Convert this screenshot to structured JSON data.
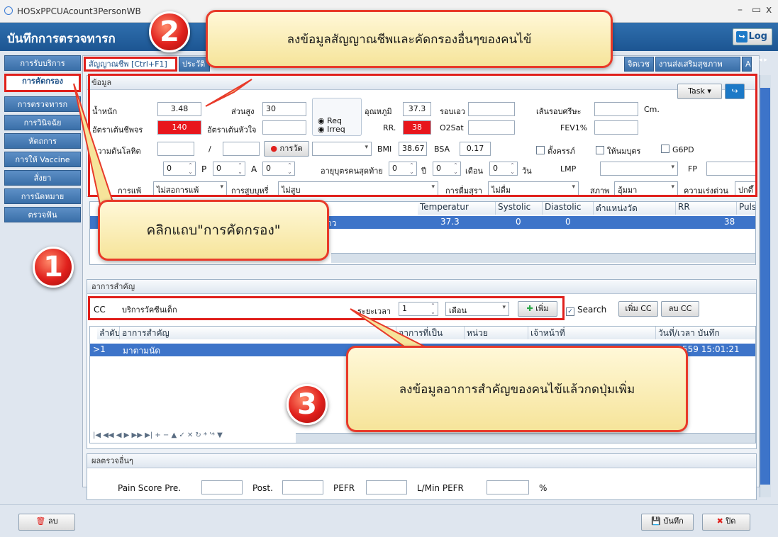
{
  "window": {
    "title": "HOSxPPCUAcount3PersonWB"
  },
  "header": {
    "title": "บันทึกการตรวจทารก",
    "log_label": "Log"
  },
  "sidebar": {
    "items": [
      {
        "label": "การรับบริการ"
      },
      {
        "label": "การคัดกรอง"
      },
      {
        "label": "การตรวจทารก"
      },
      {
        "label": "การวินิจฉัย"
      },
      {
        "label": "หัตถการ"
      },
      {
        "label": "การให้ Vaccine"
      },
      {
        "label": "สั่งยา"
      },
      {
        "label": "การนัดหมาย"
      },
      {
        "label": "ตรวจฟัน"
      }
    ]
  },
  "tabs": [
    {
      "label": "สัญญาณชีพ [Ctrl+F1]"
    },
    {
      "label": "ประวัติ"
    },
    {
      "label": "จิตเวช"
    },
    {
      "label": "งานส่งเสริมสุขภาพ"
    },
    {
      "label": "A"
    }
  ],
  "vitals": {
    "section_title": "ข้อมูล",
    "task_label": "Task",
    "weight_label": "น้ำหนัก",
    "weight": "3.48",
    "height_label": "ส่วนสูง",
    "height": "30",
    "temp_label": "อุณหภูมิ",
    "temp": "37.3",
    "waist_label": "รอบเอว",
    "head_label": "เส้นรอบศรีษะ",
    "head_unit": "Cm.",
    "pulse_label": "อัตราเต้นชีพจร",
    "pulse": "140",
    "heart_label": "อัตราเต้นหัวใจ",
    "req_label": "Req",
    "irreq_label": "Irreq",
    "rr_label": "RR.",
    "rr": "38",
    "o2_label": "O2Sat",
    "fev_label": "FEV1%",
    "bp_label": "ความดันโลหิต",
    "bp_sep": "/",
    "measure_label": "การวัด",
    "bmi_label": "BMI",
    "bmi": "38.67",
    "bsa_label": "BSA",
    "bsa": "0.17",
    "pregnant_label": "ตั้งครรภ์",
    "breastfeed_label": "ให้นมบุตร",
    "g6pd_label": "G6PD",
    "g_val": "0",
    "p_label": "P",
    "p_val": "0",
    "a_label": "A",
    "a_val": "0",
    "last_age_label": "อายุบุตรคนสุดท้าย",
    "age_y": "0",
    "y_label": "ปี",
    "age_m": "0",
    "m_label": "เดือน",
    "age_d": "0",
    "d_label": "วัน",
    "lmp_label": "LMP",
    "fp_label": "FP",
    "allergy_label": "การแพ้",
    "allergy_val": "ไม่สอการแพ้",
    "smoke_label": "การสูบบุหรี่",
    "smoke_val": "ไม่สูบ",
    "drink_label": "การดื่มสุรา",
    "drink_val": "ไม่ดื่ม",
    "status_label": "สภาพ",
    "status_val": "อุ้มมา",
    "urgency_label": "ความเร่งด่วน",
    "urgency_val": "ปกติ"
  },
  "vitals_grid": {
    "columns": [
      "Temperatur",
      "Systolic",
      "Diastolic",
      "ตำแหน่งวัด",
      "RR",
      "Pulse"
    ],
    "row": {
      "first": "าว",
      "temperature": "37.3",
      "systolic": "0",
      "diastolic": "0",
      "position": "",
      "rr": "38",
      "pulse": ""
    }
  },
  "cc": {
    "section_title": "อาการสำคัญ",
    "cc_label": "CC",
    "cc_value": "บริการวัคซีนเด็ก",
    "duration_label": "ระยะเวลา",
    "duration": "1",
    "unit": "เดือน",
    "add_label": "เพิ่ม",
    "search_label": "Search",
    "add_cc_label": "เพิ่ม CC",
    "del_cc_label": "ลบ CC"
  },
  "cc_grid": {
    "columns": [
      "ลำดับ",
      "อาการสำคัญ",
      "อาการที่เป็น",
      "หน่วย",
      "เจ้าหน้าที่",
      "วันที่/เวลา บันทึก"
    ],
    "row": {
      "no": "1",
      "symptom": "มาตามนัด",
      "datetime": "/12/2559 15:01:21"
    },
    "nav": "|◀ ◀◀ ◀ ▶ ▶▶ ▶| + − ▲ ✓ ✕ ↻ * '* ▼"
  },
  "other": {
    "section_title": "ผลตรวจอื่นๆ",
    "pain_label": "Pain Score Pre.",
    "post_label": "Post.",
    "pefr_label": "PEFR",
    "lmin_label": "L/Min  PEFR",
    "pct_label": "%"
  },
  "footer": {
    "delete_label": "ลบ",
    "save_label": "บันทึก",
    "close_label": "ปิด"
  },
  "callouts": {
    "c1": "คลิกแถบ\"การคัดกรอง\"",
    "c2": "ลงข้อมูลสัญญาณชีพและคัดกรองอื่นๆของคนไข้",
    "c3": "ลงข้อมูลอาการสำคัญของคนไข้แล้วกดปุ่มเพิ่ม",
    "n1": "1",
    "n2": "2",
    "n3": "3"
  },
  "colors": {
    "accent": "#1c5592",
    "highlight_red": "#e0201c",
    "selection": "#3d74c9"
  }
}
